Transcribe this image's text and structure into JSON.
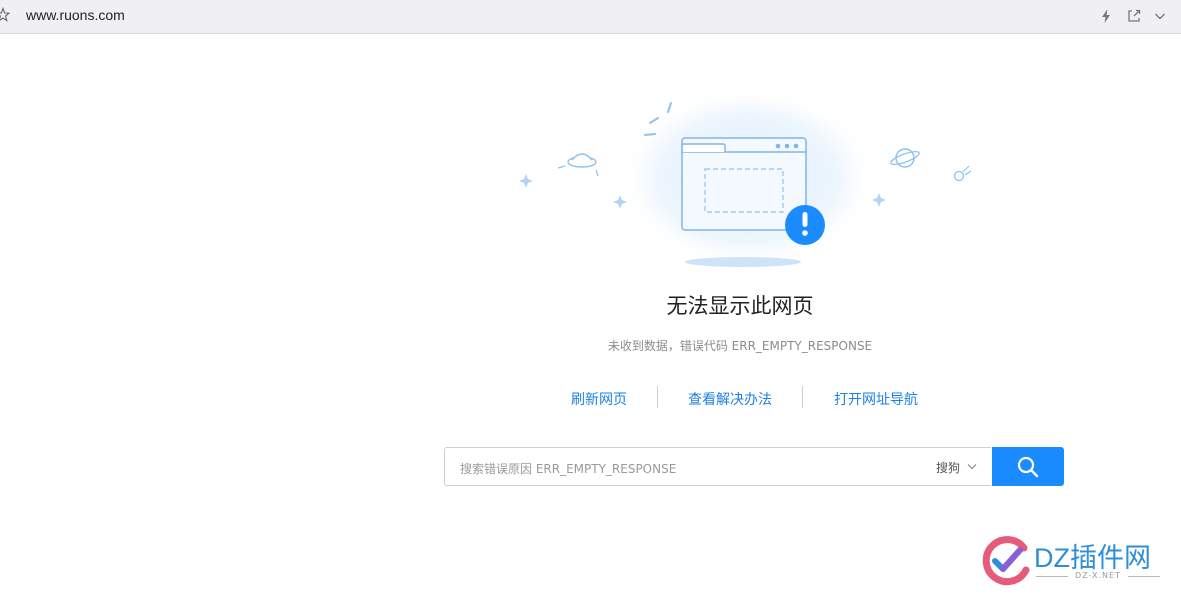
{
  "browser": {
    "url": "www.ruons.com",
    "icons": [
      "bookmark-star-icon",
      "lightning-icon",
      "share-icon",
      "chevron-down-icon"
    ]
  },
  "error": {
    "title": "无法显示此网页",
    "subtitle": "未收到数据，错误代码 ERR_EMPTY_RESPONSE"
  },
  "actions": {
    "refresh": "刷新网页",
    "solutions": "查看解决办法",
    "navigation": "打开网址导航"
  },
  "search": {
    "placeholder": "搜索错误原因 ERR_EMPTY_RESPONSE",
    "engine": "搜狗",
    "button_icon": "search-icon"
  },
  "watermark": {
    "brand": "DZ插件网",
    "domain": "DZ-X.NET"
  },
  "colors": {
    "accent": "#1a8cff",
    "link": "#1e7fe6",
    "title": "#222222",
    "muted": "#8c8c8c"
  }
}
